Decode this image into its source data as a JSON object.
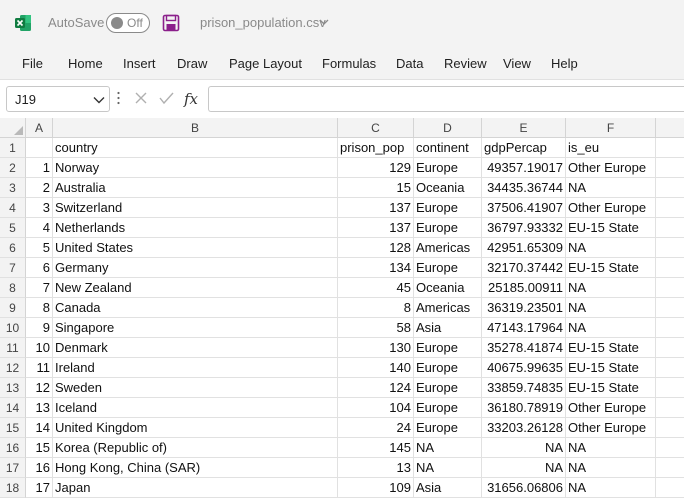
{
  "titlebar": {
    "autosave_label": "AutoSave",
    "autosave_state": "Off",
    "filename": "prison_population.csv"
  },
  "menu": [
    "File",
    "Home",
    "Insert",
    "Draw",
    "Page Layout",
    "Formulas",
    "Data",
    "Review",
    "View",
    "Help"
  ],
  "formula_bar": {
    "name_box": "J19",
    "formula": ""
  },
  "sheet": {
    "columns": [
      "A",
      "B",
      "C",
      "D",
      "E",
      "F"
    ],
    "row_numbers": [
      "1",
      "2",
      "3",
      "4",
      "5",
      "6",
      "7",
      "8",
      "9",
      "10",
      "11",
      "12",
      "13",
      "14",
      "15",
      "16",
      "17",
      "18"
    ],
    "rows": [
      [
        "",
        "country",
        "prison_pop",
        "continent",
        "gdpPercap",
        "is_eu"
      ],
      [
        "1",
        "Norway",
        "129",
        "Europe",
        "49357.19017",
        "Other Europe"
      ],
      [
        "2",
        "Australia",
        "15",
        "Oceania",
        "34435.36744",
        "NA"
      ],
      [
        "3",
        "Switzerland",
        "137",
        "Europe",
        "37506.41907",
        "Other Europe"
      ],
      [
        "4",
        "Netherlands",
        "137",
        "Europe",
        "36797.93332",
        "EU-15 State"
      ],
      [
        "5",
        "United States",
        "128",
        "Americas",
        "42951.65309",
        "NA"
      ],
      [
        "6",
        "Germany",
        "134",
        "Europe",
        "32170.37442",
        "EU-15 State"
      ],
      [
        "7",
        "New Zealand",
        "45",
        "Oceania",
        "25185.00911",
        "NA"
      ],
      [
        "8",
        "Canada",
        "8",
        "Americas",
        "36319.23501",
        "NA"
      ],
      [
        "9",
        "Singapore",
        "58",
        "Asia",
        "47143.17964",
        "NA"
      ],
      [
        "10",
        "Denmark",
        "130",
        "Europe",
        "35278.41874",
        "EU-15 State"
      ],
      [
        "11",
        "Ireland",
        "140",
        "Europe",
        "40675.99635",
        "EU-15 State"
      ],
      [
        "12",
        "Sweden",
        "124",
        "Europe",
        "33859.74835",
        "EU-15 State"
      ],
      [
        "13",
        "Iceland",
        "104",
        "Europe",
        "36180.78919",
        "Other Europe"
      ],
      [
        "14",
        "United Kingdom",
        "24",
        "Europe",
        "33203.26128",
        "Other Europe"
      ],
      [
        "15",
        "Korea (Republic of)",
        "145",
        "NA",
        "NA",
        "NA"
      ],
      [
        "16",
        "Hong Kong, China (SAR)",
        "13",
        "NA",
        "NA",
        "NA"
      ],
      [
        "17",
        "Japan",
        "109",
        "Asia",
        "31656.06806",
        "NA"
      ]
    ]
  },
  "colors": {
    "excel_green": "#107C41",
    "save_purple": "#8B1F8B",
    "chrome_bg": "#f3f3f3",
    "grid_line": "#e1e1e1"
  },
  "icons": {
    "app": "excel-logo-icon",
    "save": "save-icon",
    "cancel": "cancel-x-icon",
    "enter": "check-icon",
    "function": "fx-icon"
  }
}
